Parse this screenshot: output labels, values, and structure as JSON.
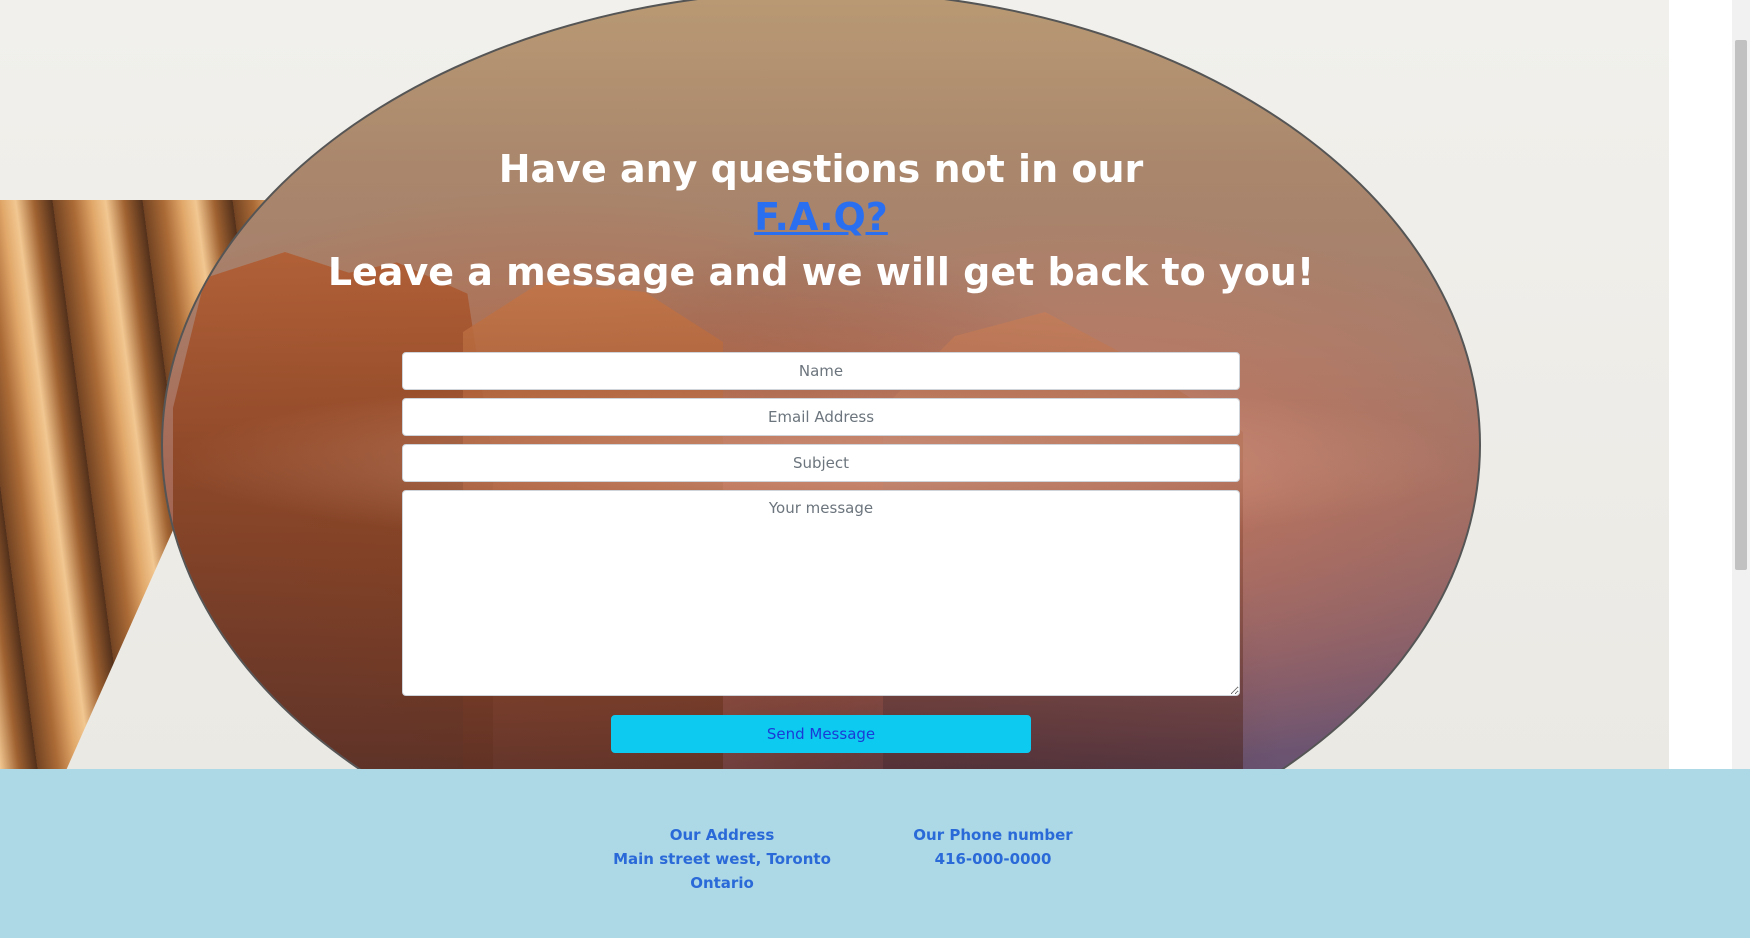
{
  "hero": {
    "question_line": "Have any questions not in our",
    "faq_link": "F.A.Q?",
    "message_line": "Leave a message and we will get back to you!"
  },
  "form": {
    "name_placeholder": "Name",
    "email_placeholder": "Email Address",
    "subject_placeholder": "Subject",
    "message_placeholder": "Your message",
    "send_label": "Send Message"
  },
  "footer": {
    "address_title": "Our Address",
    "address_value": "Main street west, Toronto Ontario",
    "phone_title": "Our Phone number",
    "phone_value": "416-000-0000"
  },
  "colors": {
    "link": "#2a6ff0",
    "button": "#0dcaf0",
    "footer_bg": "#add8e6",
    "footer_text": "#2a6ad8"
  }
}
